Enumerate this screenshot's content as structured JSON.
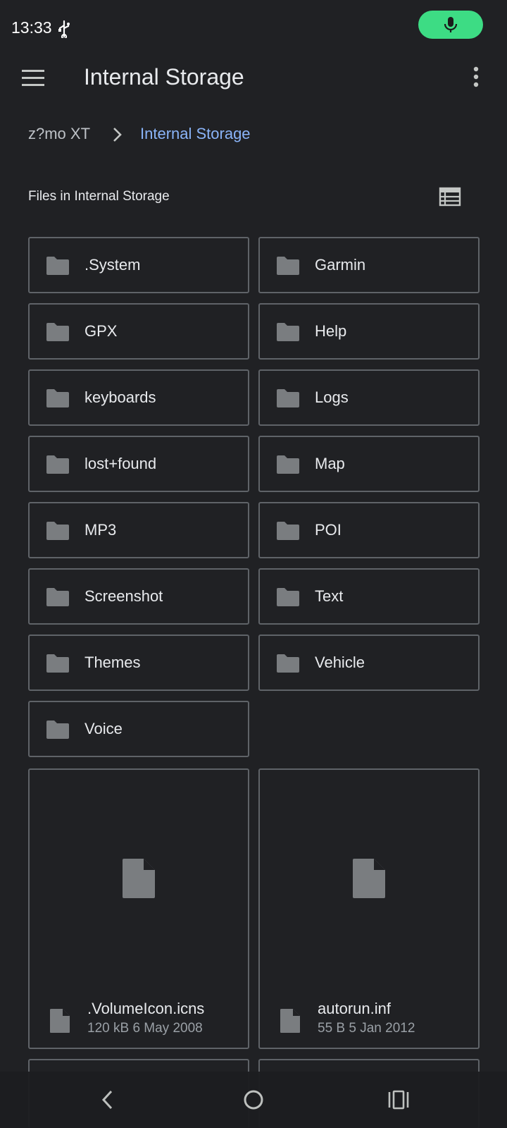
{
  "status_bar": {
    "time": "13:33",
    "icons": [
      "usb-icon",
      "mic-icon"
    ],
    "mic_color": "#3ddc84"
  },
  "app_bar": {
    "title": "Internal Storage",
    "icons": [
      "menu-icon",
      "overflow-menu-icon"
    ]
  },
  "breadcrumb": {
    "root": "z?mo XT",
    "current": "Internal Storage",
    "current_color": "#8ab4f8"
  },
  "section": {
    "title": "Files in Internal Storage",
    "view_toggle_icon": "list-view-icon"
  },
  "folders": [
    {
      "name": ".System"
    },
    {
      "name": "Garmin"
    },
    {
      "name": "GPX"
    },
    {
      "name": "Help"
    },
    {
      "name": "keyboards"
    },
    {
      "name": "Logs"
    },
    {
      "name": "lost+found"
    },
    {
      "name": "Map"
    },
    {
      "name": "MP3"
    },
    {
      "name": "POI"
    },
    {
      "name": "Screenshot"
    },
    {
      "name": "Text"
    },
    {
      "name": "Themes"
    },
    {
      "name": "Vehicle"
    },
    {
      "name": "Voice"
    }
  ],
  "files": [
    {
      "name": ".VolumeIcon.icns",
      "size": "120 kB",
      "date": "6 May 2008"
    },
    {
      "name": "autorun.inf",
      "size": "55 B",
      "date": "5 Jan 2012"
    }
  ],
  "nav_bar": {
    "icons": [
      "back-icon",
      "home-icon",
      "recents-icon"
    ]
  }
}
